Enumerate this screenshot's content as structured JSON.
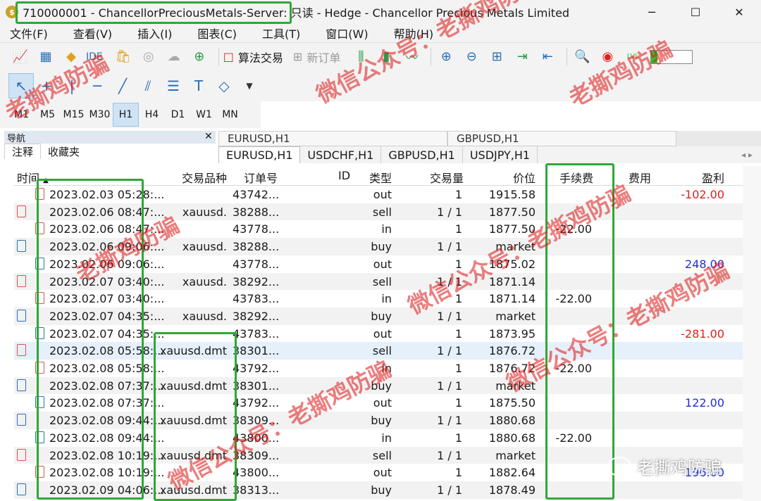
{
  "window": {
    "title": "710000001 - ChancellorPreciousMetals-Server: 只读 - Hedge - Chancellor Precious Metals Limited",
    "app_icon": "mt5-icon"
  },
  "menu": [
    "文件(F)",
    "查看(V)",
    "插入(I)",
    "图表(C)",
    "工具(T)",
    "窗口(W)",
    "帮助(H)"
  ],
  "toolbar": {
    "ide_label": "IDE",
    "algo_label": "算法交易",
    "new_order_label": "新订单",
    "progress_fraction": 0.15,
    "progress_color": "#2ec22e"
  },
  "periods": [
    "M1",
    "M5",
    "M15",
    "M30",
    "H1",
    "H4",
    "D1",
    "W1",
    "MN"
  ],
  "active_period": "H1",
  "navigator": {
    "title": "导航",
    "tabs": [
      "注释",
      "收藏夹"
    ]
  },
  "chart_tabs": [
    "EURUSD,H1",
    "GBPUSD,H1"
  ],
  "symbol_tabs": [
    "EURUSD,H1",
    "USDCHF,H1",
    "GBPUSD,H1",
    "USDJPY,H1"
  ],
  "table": {
    "columns": {
      "time": "时间",
      "symbol": "交易品种",
      "order": "订单号",
      "id": "ID",
      "type": "类型",
      "volume": "交易量",
      "price": "价位",
      "commission": "手续费",
      "fee": "费用",
      "profit": "盈利"
    },
    "rows": [
      {
        "icon": "red",
        "indent": true,
        "time": "2023.02.03 05:28:...",
        "symbol": "",
        "order": "43742...",
        "type": "out",
        "volume": "1",
        "price": "1915.58",
        "commission": "",
        "profit": "-102.00"
      },
      {
        "icon": "red",
        "indent": false,
        "time": "2023.02.06 08:47:...",
        "symbol": "xauusd.",
        "order": "38288...",
        "type": "sell",
        "volume": "1 / 1",
        "price": "1877.50",
        "commission": "",
        "profit": ""
      },
      {
        "icon": "red",
        "indent": true,
        "time": "2023.02.06 08:47:...",
        "symbol": "",
        "order": "43778...",
        "type": "in",
        "volume": "1",
        "price": "1877.50",
        "commission": "-22.00",
        "profit": ""
      },
      {
        "icon": "blue",
        "indent": false,
        "time": "2023.02.06 09:06:...",
        "symbol": "xauusd.",
        "order": "38288...",
        "type": "buy",
        "volume": "1 / 1",
        "price": "market",
        "commission": "",
        "profit": ""
      },
      {
        "icon": "blue",
        "indent": true,
        "time": "2023.02.06 09:06:...",
        "symbol": "",
        "order": "43778...",
        "type": "out",
        "volume": "1",
        "price": "1875.02",
        "commission": "",
        "profit": "248.00"
      },
      {
        "icon": "red",
        "indent": false,
        "time": "2023.02.07 03:40:...",
        "symbol": "xauusd.",
        "order": "38292...",
        "type": "sell",
        "volume": "1 / 1",
        "price": "1871.14",
        "commission": "",
        "profit": ""
      },
      {
        "icon": "red",
        "indent": true,
        "time": "2023.02.07 03:40:...",
        "symbol": "",
        "order": "43783...",
        "type": "in",
        "volume": "1",
        "price": "1871.14",
        "commission": "-22.00",
        "profit": ""
      },
      {
        "icon": "blue",
        "indent": false,
        "time": "2023.02.07 04:35:...",
        "symbol": "xauusd.",
        "order": "38292...",
        "type": "buy",
        "volume": "1 / 1",
        "price": "market",
        "commission": "",
        "profit": ""
      },
      {
        "icon": "blue",
        "indent": true,
        "time": "2023.02.07 04:35:...",
        "symbol": "",
        "order": "43783...",
        "type": "out",
        "volume": "1",
        "price": "1873.95",
        "commission": "",
        "profit": "-281.00"
      },
      {
        "icon": "red",
        "indent": false,
        "time": "2023.02.08 05:58:...",
        "symbol": "xauusd.dmt",
        "order": "38301...",
        "type": "sell",
        "volume": "1 / 1",
        "price": "1876.72",
        "commission": "",
        "profit": ""
      },
      {
        "icon": "red",
        "indent": true,
        "time": "2023.02.08 05:58:...",
        "symbol": "",
        "order": "43792...",
        "type": "in",
        "volume": "1",
        "price": "1876.72",
        "commission": "-22.00",
        "profit": ""
      },
      {
        "icon": "blue",
        "indent": false,
        "time": "2023.02.08 07:37:...",
        "symbol": "xauusd.dmt",
        "order": "38301...",
        "type": "buy",
        "volume": "1 / 1",
        "price": "market",
        "commission": "",
        "profit": ""
      },
      {
        "icon": "blue",
        "indent": true,
        "time": "2023.02.08 07:37:...",
        "symbol": "",
        "order": "43792...",
        "type": "out",
        "volume": "1",
        "price": "1875.50",
        "commission": "",
        "profit": "122.00"
      },
      {
        "icon": "blue",
        "indent": false,
        "time": "2023.02.08 09:44:...",
        "symbol": "xauusd.dmt",
        "order": "38309...",
        "type": "buy",
        "volume": "1 / 1",
        "price": "1880.68",
        "commission": "",
        "profit": ""
      },
      {
        "icon": "blue",
        "indent": true,
        "time": "2023.02.08 09:44:...",
        "symbol": "",
        "order": "43800...",
        "type": "in",
        "volume": "1",
        "price": "1880.68",
        "commission": "-22.00",
        "profit": ""
      },
      {
        "icon": "red",
        "indent": false,
        "time": "2023.02.08 10:19:...",
        "symbol": "xauusd.dmt",
        "order": "38309...",
        "type": "sell",
        "volume": "1 / 1",
        "price": "market",
        "commission": "",
        "profit": ""
      },
      {
        "icon": "red",
        "indent": true,
        "time": "2023.02.08 10:19:...",
        "symbol": "",
        "order": "43800...",
        "type": "out",
        "volume": "1",
        "price": "1882.64",
        "commission": "",
        "profit": "196.00"
      },
      {
        "icon": "blue",
        "indent": false,
        "time": "2023.02.09 04:06:...",
        "symbol": "xauusd.dmt",
        "order": "38313...",
        "type": "buy",
        "volume": "1 / 1",
        "price": "1878.49",
        "commission": "",
        "profit": ""
      }
    ]
  },
  "watermarks": {
    "a": "老撕鸡防骗",
    "b": "微信公众号：老撕鸡防骗",
    "badge": "老撕鸡防骗"
  },
  "colors": {
    "highlight_box": "#2ea836",
    "negative": "#e02020",
    "positive": "#1f2fd6"
  }
}
